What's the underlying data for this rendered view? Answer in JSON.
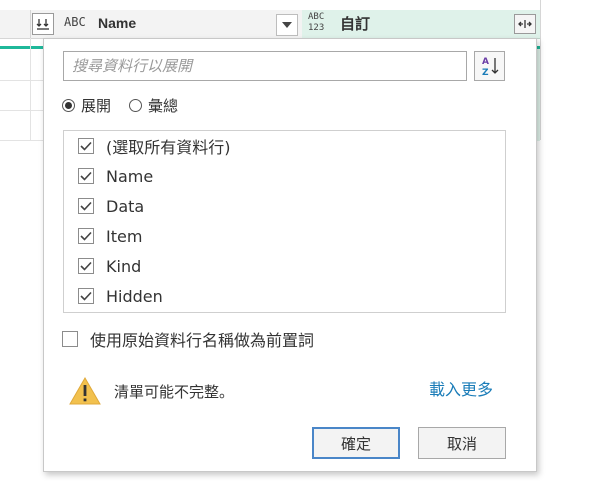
{
  "header": {
    "col1_type": "ABC",
    "col1_name": "Name",
    "col2_type_top": "ABC",
    "col2_type_bottom": "123",
    "col2_name": "自訂"
  },
  "popup": {
    "search_placeholder": "搜尋資料行以展開",
    "search_value": "",
    "radio_expand": "展開",
    "radio_aggregate": "彙總",
    "selected_mode": "expand",
    "items": [
      {
        "label": "(選取所有資料行)",
        "checked": true
      },
      {
        "label": "Name",
        "checked": true
      },
      {
        "label": "Data",
        "checked": true
      },
      {
        "label": "Item",
        "checked": true
      },
      {
        "label": "Kind",
        "checked": true
      },
      {
        "label": "Hidden",
        "checked": true
      }
    ],
    "prefix_label": "使用原始資料行名稱做為前置詞",
    "prefix_checked": false,
    "warning": "清單可能不完整。",
    "load_more": "載入更多",
    "ok": "確定",
    "cancel": "取消"
  },
  "colors": {
    "accent_teal": "#1fb89a",
    "link_blue": "#1a7cb8",
    "warning_yellow": "#f2c14e",
    "ok_border": "#4a86c8"
  }
}
